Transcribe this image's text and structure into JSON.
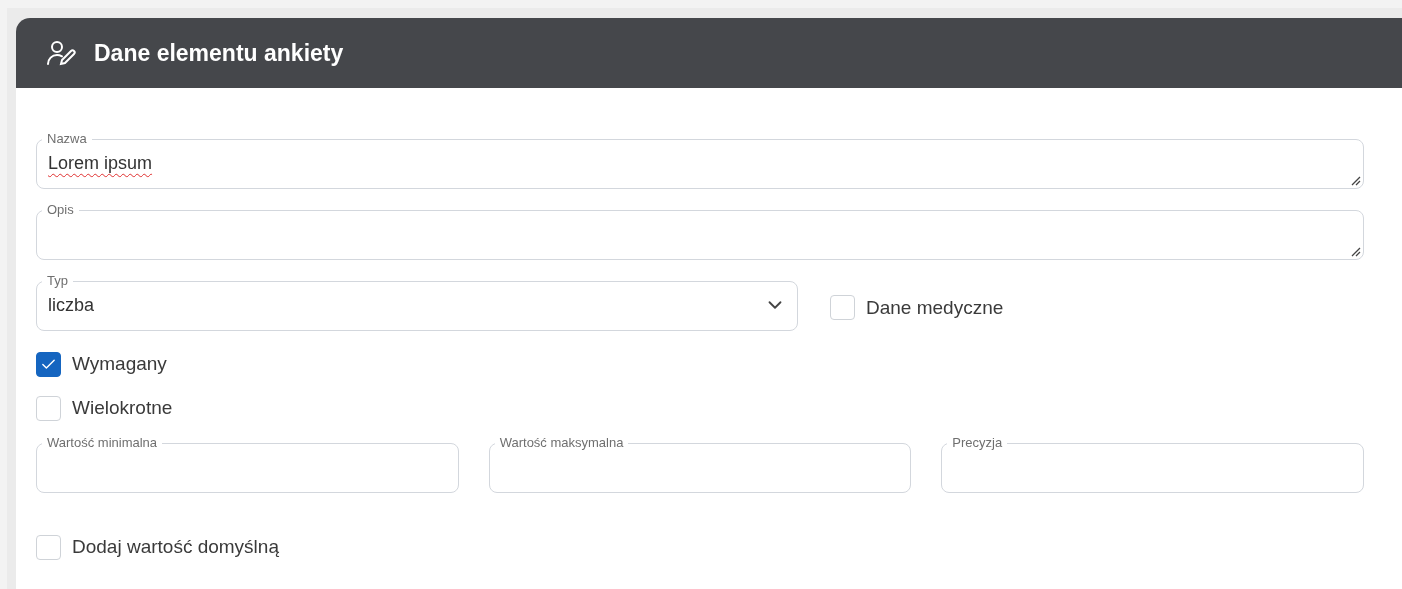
{
  "header": {
    "title": "Dane elementu ankiety"
  },
  "text_areas": [
    {
      "label": "Nazwa",
      "value": "Lorem ipsum",
      "misspelled": true
    },
    {
      "label": "Opis"
    }
  ],
  "type_select": {
    "label": "Typ",
    "value": "liczba"
  },
  "medical_checkbox": {
    "label": "Dane medyczne",
    "checked": false
  },
  "checkboxes": [
    {
      "label": "Wymagany",
      "checked": true
    },
    {
      "label": "Wielokrotne",
      "checked": false
    }
  ],
  "number_fields": [
    {
      "label": "Wartość minimalna"
    },
    {
      "label": "Wartość maksymalna"
    },
    {
      "label": "Precyzja"
    }
  ],
  "default_checkbox": {
    "label": "Dodaj wartość domyślną",
    "checked": false
  }
}
